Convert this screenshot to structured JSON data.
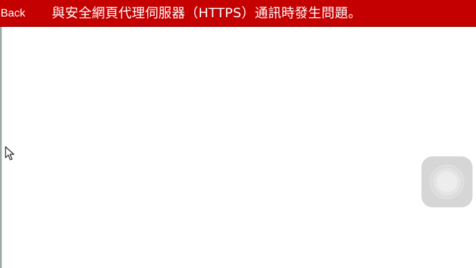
{
  "header": {
    "back_label": "Back",
    "title": "與安全網頁代理伺服器（HTTPS）通訊時發生問題。"
  },
  "icons": {
    "cursor": "mouse-pointer-icon",
    "assistive_touch": "assistive-touch-icon"
  },
  "colors": {
    "header_background": "#c40000",
    "header_text": "#ffffff",
    "page_background": "#ffffff",
    "assistive_touch_background": "#d6d6d6"
  }
}
